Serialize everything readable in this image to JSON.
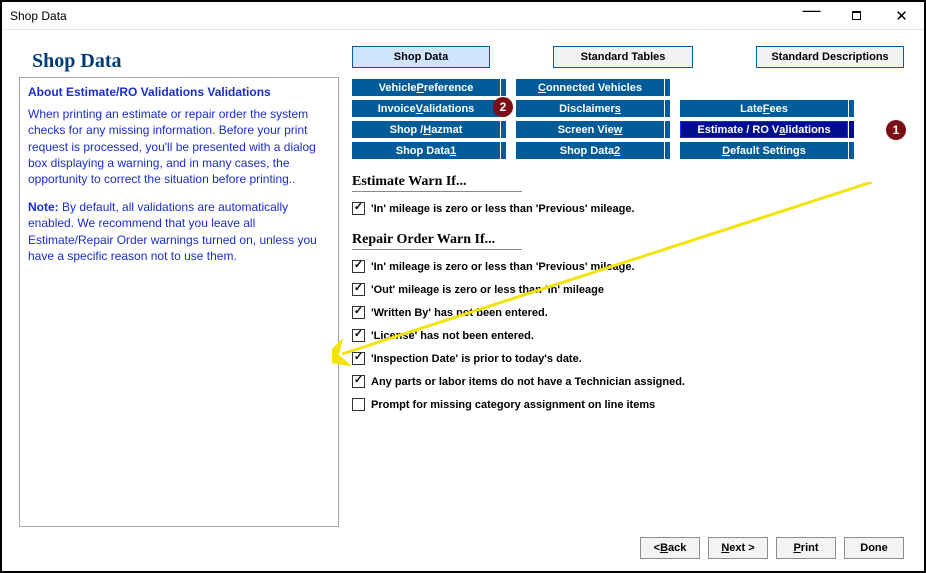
{
  "window_title": "Shop Data",
  "page_title": "Shop Data",
  "top_tabs": {
    "shop_data": "Shop Data",
    "standard_tables": "Standard Tables",
    "standard_descriptions": "Standard Descriptions"
  },
  "nav": {
    "col1": [
      {
        "prefix": "Vehicle ",
        "ul": "P",
        "suffix": "reference"
      },
      {
        "prefix": "Invoice ",
        "ul": "V",
        "suffix": "alidations"
      },
      {
        "prefix": "Shop / ",
        "ul": "H",
        "suffix": "azmat"
      },
      {
        "prefix": "Shop Data ",
        "ul": "1",
        "suffix": ""
      }
    ],
    "col2": [
      {
        "prefix": "",
        "ul": "C",
        "suffix": "onnected Vehicles"
      },
      {
        "prefix": "Disclaimer",
        "ul": "s",
        "suffix": ""
      },
      {
        "prefix": "Screen Vie",
        "ul": "w",
        "suffix": ""
      },
      {
        "prefix": "Shop Data ",
        "ul": "2",
        "suffix": ""
      }
    ],
    "col3": [
      {
        "prefix": "",
        "ul": "",
        "suffix": ""
      },
      {
        "prefix": "Late ",
        "ul": "F",
        "suffix": "ees"
      },
      {
        "prefix": "Estimate / RO V",
        "ul": "a",
        "suffix": "lidations",
        "selected": true
      },
      {
        "prefix": "",
        "ul": "D",
        "suffix": "efault Settings"
      }
    ]
  },
  "about": {
    "title": "About Estimate/RO Validations Validations",
    "body1": "When printing an estimate or repair order the system checks for any missing information. Before your print request is processed, you'll be presented with a dialog box displaying a warning, and in many cases, the opportunity to correct the situation before printing..",
    "note_label": "Note:",
    "body2": " By default, all validations are automatically enabled. We recommend that you leave all Estimate/Repair Order warnings turned on, unless you have a specific reason not to use them."
  },
  "sections": {
    "estimate_title": "Estimate Warn If...",
    "repair_title": "Repair Order Warn If..."
  },
  "estimate_checks": [
    {
      "checked": true,
      "label": "'In'  mileage is zero or less than 'Previous' mileage."
    }
  ],
  "repair_checks": [
    {
      "checked": true,
      "label": "'In'  mileage is zero or less than 'Previous' mileage."
    },
    {
      "checked": true,
      "label": "'Out' mileage is zero or less than 'In' mileage"
    },
    {
      "checked": true,
      "label": "'Written By' has not been entered."
    },
    {
      "checked": true,
      "label": "'License' has not been entered."
    },
    {
      "checked": true,
      "label": "'Inspection Date' is prior to today's date."
    },
    {
      "checked": true,
      "label": "Any parts or labor items do not have a Technician assigned."
    },
    {
      "checked": false,
      "label": "Prompt for missing category assignment on line items"
    }
  ],
  "footer": {
    "back": {
      "lt": "< ",
      "ul": "B",
      "suffix": "ack"
    },
    "next": {
      "ul": "N",
      "suffix": "ext >"
    },
    "print": {
      "ul": "P",
      "suffix": "rint"
    },
    "done": "Done"
  },
  "callouts": {
    "one": "1",
    "two": "2"
  }
}
